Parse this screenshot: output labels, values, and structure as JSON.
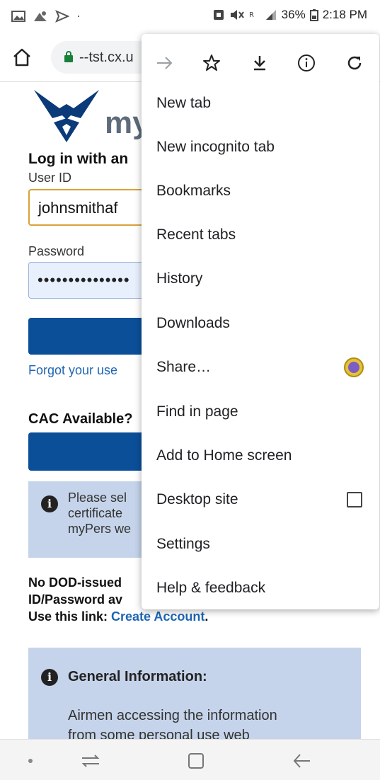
{
  "status_bar": {
    "battery": "36%",
    "time": "2:18 PM"
  },
  "browser": {
    "url": "--tst.cx.u"
  },
  "page": {
    "logo_text": "my",
    "login_title": "Log in with an",
    "userid_label": "User ID",
    "userid_value": "johnsmithaf",
    "password_label": "Password",
    "password_value": "•••••••••••••••",
    "forgot_link": "Forgot your use",
    "cac_title": "CAC Available?",
    "info_text_lines": [
      "Please sel",
      "certificate",
      "myPers we"
    ],
    "dod_line1": "No DOD-issued",
    "dod_line2": "ID/Password av",
    "dod_line3_prefix": "Use this link: ",
    "dod_link": "Create Account",
    "dod_line3_suffix": ".",
    "general_info_title": "General Information:",
    "general_info_body_line1": "Airmen accessing the information",
    "general_info_body_line2": "from some personal use web"
  },
  "menu": {
    "toolbar_icons": [
      "forward-arrow-icon",
      "star-icon",
      "download-icon",
      "info-icon",
      "refresh-icon"
    ],
    "items": [
      {
        "label": "New tab"
      },
      {
        "label": "New incognito tab"
      },
      {
        "label": "Bookmarks"
      },
      {
        "label": "Recent tabs"
      },
      {
        "label": "History"
      },
      {
        "label": "Downloads"
      },
      {
        "label": "Share…"
      },
      {
        "label": "Find in page"
      },
      {
        "label": "Add to Home screen"
      },
      {
        "label": "Desktop site"
      },
      {
        "label": "Settings"
      },
      {
        "label": "Help & feedback"
      }
    ]
  },
  "colors": {
    "primary_button": "#0b4f99",
    "link": "#1f66b3",
    "info_box": "#c5d4ea",
    "userid_border": "#d9a13b"
  }
}
